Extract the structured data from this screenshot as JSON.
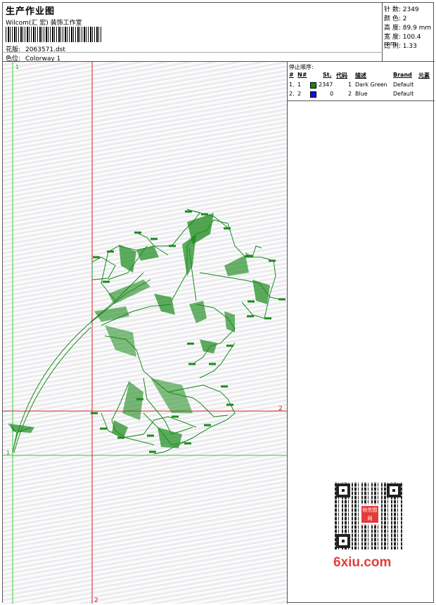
{
  "header": {
    "title": "生产作业图",
    "subtitle": "Wilcom(汇 宏) 装饰工作室",
    "design_label": "花版:",
    "design_value": "2063571.dst",
    "colorway_label": "色位:",
    "colorway_value": "Colorway 1"
  },
  "stats": {
    "stitches": "针 数: 2349",
    "colors": "颜 色: 2",
    "height": "高 度: 89.9 mm",
    "width": "宽 度: 100.4 mm",
    "ratio": "比 例: 1.33"
  },
  "canvas": {
    "axis_top_left": "1",
    "axis_bottom_left": "1",
    "axis_right": "2",
    "axis_bottom": "2",
    "stitch_color": "#1a8a1a",
    "axis_green": "#33cc33",
    "axis_red": "#dd2222"
  },
  "stop_sequence": {
    "title": "停止顺序:",
    "headers": {
      "num": "#",
      "no": "N#",
      "st": "St.",
      "code": "代码",
      "desc": "描述",
      "brand": "Brand",
      "elem": "元素"
    },
    "rows": [
      {
        "num": "1.",
        "no": "1",
        "color": "#118811",
        "st": "2347",
        "code": "1",
        "desc": "Dark Green",
        "brand": "Default"
      },
      {
        "num": "2.",
        "no": "2",
        "color": "#1111dd",
        "st": "0",
        "code": "2",
        "desc": "Blue",
        "brand": "Default"
      }
    ]
  },
  "watermark": {
    "qr_logo": "秋信图网",
    "brand": "6xiu.com"
  }
}
